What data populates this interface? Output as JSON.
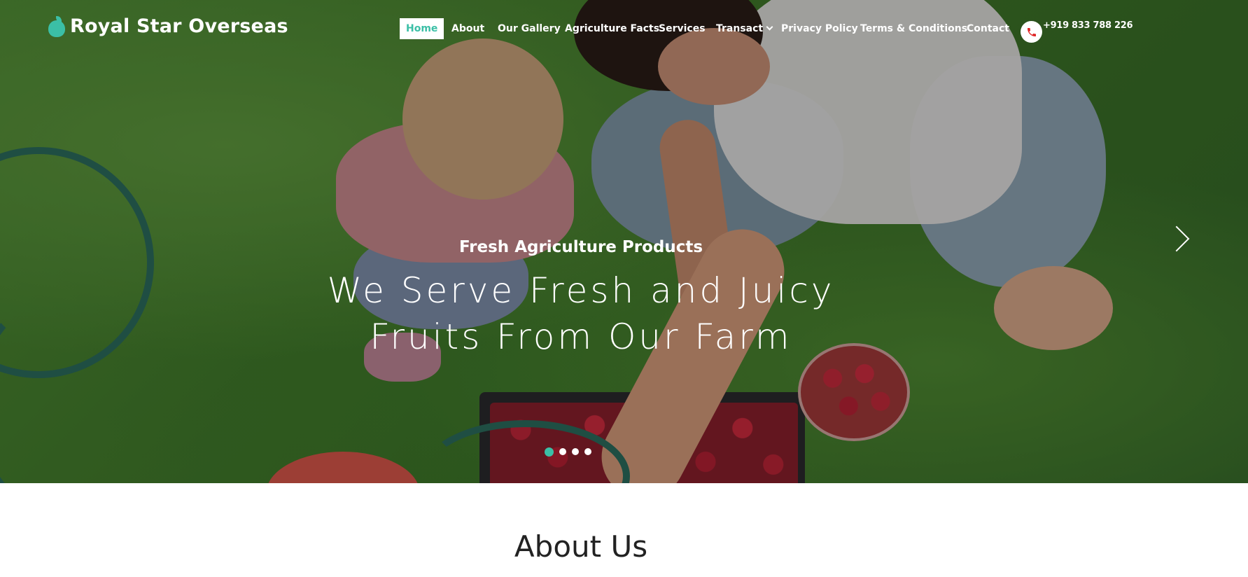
{
  "brand": {
    "name": "Royal Star Overseas",
    "icon": "apple-icon",
    "accent": "#3bbfa6"
  },
  "nav": {
    "items": [
      {
        "label": "Home",
        "active": true
      },
      {
        "label": "About"
      },
      {
        "label": "Our Gallery"
      },
      {
        "label": "Agriculture Facts"
      },
      {
        "label": "Services"
      },
      {
        "label": "Transact",
        "dropdown": true
      },
      {
        "label": "Privacy Policy"
      },
      {
        "label": "Terms & Conditions"
      },
      {
        "label": "Contact"
      }
    ],
    "phone": "+919 833 788 226",
    "phone_icon": "phone-icon",
    "phone_icon_color": "#e02424"
  },
  "hero": {
    "subtitle": "Fresh Agriculture Products",
    "title_line1": "We Serve Fresh and Juicy",
    "title_line2": "Fruits From Our Farm",
    "next_icon": "chevron-right-icon",
    "slides": 4,
    "active_slide": 1
  },
  "about": {
    "heading": "About Us"
  }
}
